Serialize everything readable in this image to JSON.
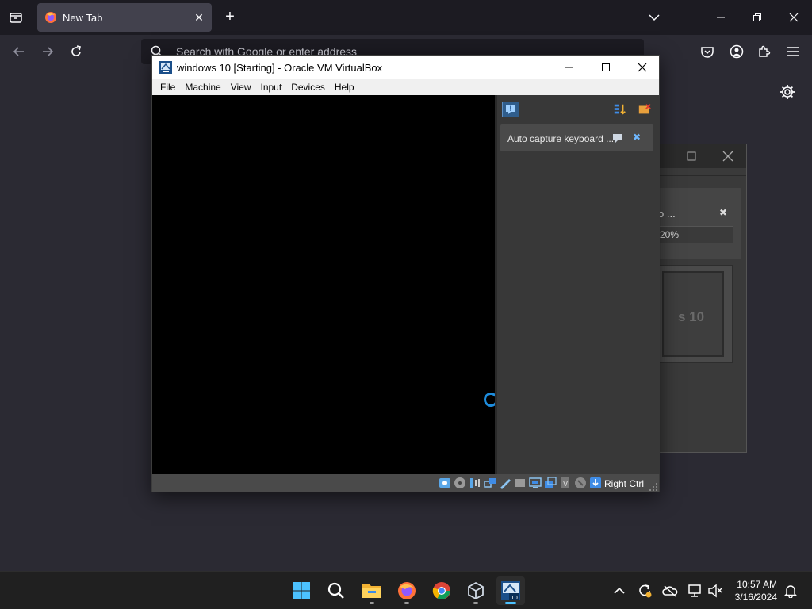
{
  "browser": {
    "tab_title": "New Tab",
    "search_placeholder": "Search with Google or enter address"
  },
  "vm_window": {
    "title": "windows 10 [Starting] - Oracle VM VirtualBox",
    "menu": [
      "File",
      "Machine",
      "View",
      "Input",
      "Devices",
      "Help"
    ],
    "notification_text": "Auto capture keyboard ...",
    "host_key": "Right Ctrl"
  },
  "bg_window": {
    "notification_fragment": "o ...",
    "progress_fragment": "20%",
    "preview_fragment": "s 10"
  },
  "taskbar": {
    "apps": [
      "start-icon",
      "search-icon",
      "file-explorer-icon",
      "firefox-icon",
      "chrome-icon",
      "virtualbox-icon",
      "virtualbox-vm-icon"
    ],
    "time": "10:57 AM",
    "date": "3/16/2024"
  },
  "colors": {
    "firefox_bg": "#2b2a33",
    "tabbar_bg": "#1c1b22",
    "accent_blue": "#1e8cdc",
    "taskbar_bg": "#202020"
  }
}
